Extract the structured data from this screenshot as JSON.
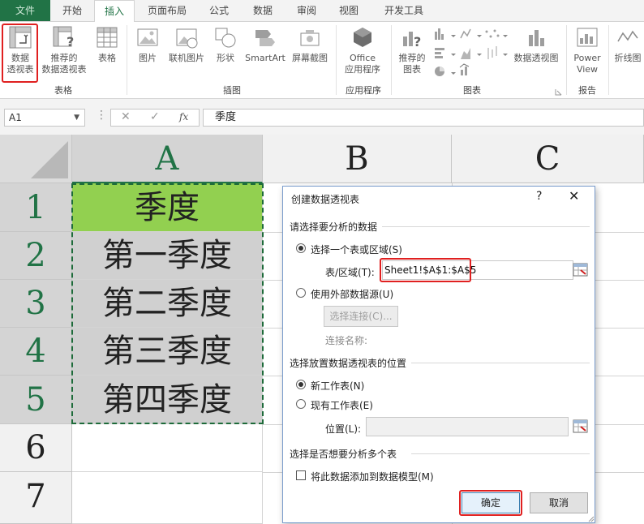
{
  "ribbon_tabs": [
    {
      "label": "文件"
    },
    {
      "label": "开始"
    },
    {
      "label": "插入"
    },
    {
      "label": "页面布局"
    },
    {
      "label": "公式"
    },
    {
      "label": "数据"
    },
    {
      "label": "审阅"
    },
    {
      "label": "视图"
    },
    {
      "label": "开发工具"
    }
  ],
  "active_tab": "插入",
  "ribbon": {
    "pivot_table_line1": "数据",
    "pivot_table_line2": "透视表",
    "recommended_pivot_line1": "推荐的",
    "recommended_pivot_line2": "数据透视表",
    "table": "表格",
    "group_tables": "表格",
    "pictures": "图片",
    "online_pictures": "联机图片",
    "shapes": "形状",
    "smartart": "SmartArt",
    "screenshot": "屏幕截图",
    "group_illustrations": "插图",
    "office_apps_line1": "Office",
    "office_apps_line2": "应用程序",
    "group_apps": "应用程序",
    "recommended_charts_line1": "推荐的",
    "recommended_charts_line2": "图表",
    "pivot_chart": "数据透视图",
    "group_charts": "图表",
    "power_view_line1": "Power",
    "power_view_line2": "View",
    "group_reports": "报告",
    "sparkline_line": "折线图"
  },
  "formula_bar": {
    "name_box": "A1",
    "cancel_glyph": "✕",
    "enter_glyph": "✓",
    "fx_glyph": "fx",
    "content": "季度"
  },
  "sheet": {
    "columns": [
      "A",
      "B",
      "C"
    ],
    "rows": [
      "1",
      "2",
      "3",
      "4",
      "5",
      "6",
      "7"
    ],
    "cells": [
      "季度",
      "第一季度",
      "第二季度",
      "第三季度",
      "第四季度"
    ]
  },
  "dialog": {
    "title": "创建数据透视表",
    "help": "?",
    "close": "✕",
    "section_choose_data": "请选择要分析的数据",
    "option_select_range": "选择一个表或区域(S)",
    "range_label": "表/区域(T):",
    "range_value": "Sheet1!$A$1:$A$5",
    "option_external": "使用外部数据源(U)",
    "choose_connection": "选择连接(C)...",
    "connection_name_label": "连接名称:",
    "section_place": "选择放置数据透视表的位置",
    "option_new_sheet": "新工作表(N)",
    "option_existing_sheet": "现有工作表(E)",
    "location_label": "位置(L):",
    "location_value": "",
    "section_multiple": "选择是否想要分析多个表",
    "add_to_model": "将此数据添加到数据模型(M)",
    "ok": "确定",
    "cancel": "取消"
  },
  "colors": {
    "excel_green": "#217346",
    "highlight_red": "#e02020",
    "header_cell_green": "#92d050",
    "data_cell_gray": "#d0d0d0"
  }
}
